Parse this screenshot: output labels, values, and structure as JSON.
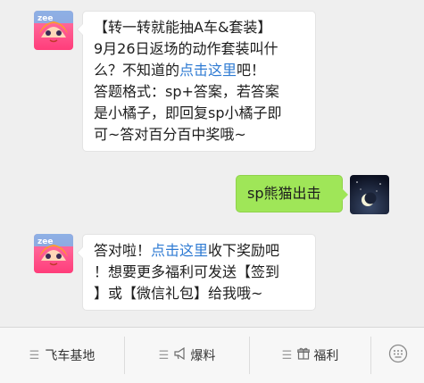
{
  "messages": [
    {
      "side": "left",
      "lines": [
        {
          "parts": [
            {
              "text": "【转一转就能抽A车&套装】"
            }
          ]
        },
        {
          "parts": [
            {
              "text": "9月26日返场的动作套装叫什"
            }
          ]
        },
        {
          "parts": [
            {
              "text": "么？不知道的"
            },
            {
              "text": "点击这里",
              "link": true
            },
            {
              "text": "吧！"
            }
          ]
        },
        {
          "parts": [
            {
              "text": "答题格式：sp+答案，若答案"
            }
          ]
        },
        {
          "parts": [
            {
              "text": "是小橘子，即回复sp小橘子即"
            }
          ]
        },
        {
          "parts": [
            {
              "text": "可~答对百分百中奖哦~"
            }
          ]
        }
      ]
    },
    {
      "side": "right",
      "lines": [
        {
          "parts": [
            {
              "text": "sp熊猫出击"
            }
          ]
        }
      ]
    },
    {
      "side": "left",
      "lines": [
        {
          "parts": [
            {
              "text": "答对啦！"
            },
            {
              "text": "点击这里",
              "link": true
            },
            {
              "text": "收下奖励吧"
            }
          ]
        },
        {
          "parts": [
            {
              "text": "！想要更多福利可发送【签到"
            }
          ]
        },
        {
          "parts": [
            {
              "text": "】或【微信礼包】给我哦~"
            }
          ]
        }
      ]
    }
  ],
  "menu": {
    "items": [
      {
        "label": "飞车基地",
        "icon": "menu-lines-icon"
      },
      {
        "label": "爆料",
        "icon": "megaphone-icon"
      },
      {
        "label": "福利",
        "icon": "gift-icon"
      }
    ],
    "keyboard_icon": "keyboard-icon"
  },
  "colors": {
    "background": "#efefef",
    "bubble_left": "#ffffff",
    "bubble_right": "#9fe658",
    "link": "#2f7bd3"
  }
}
